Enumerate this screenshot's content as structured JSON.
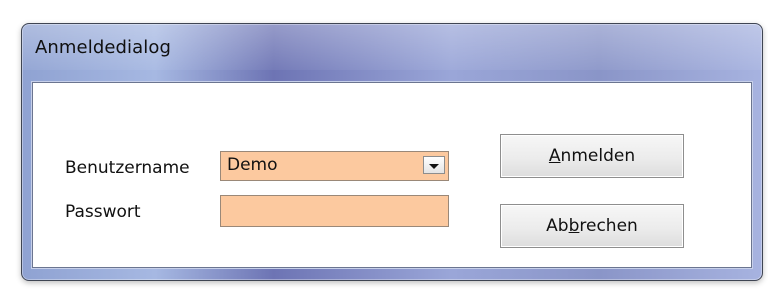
{
  "window": {
    "title": "Anmeldedialog"
  },
  "form": {
    "username_label": "Benutzername",
    "username_value": "Demo",
    "password_label": "Passwort",
    "password_value": ""
  },
  "buttons": {
    "login": {
      "pre": "",
      "mnemonic": "A",
      "post": "nmelden"
    },
    "cancel": {
      "pre": "Ab",
      "mnemonic": "b",
      "post": "rechen"
    }
  },
  "icons": {
    "dropdown": "chevron-down-icon"
  },
  "colors": {
    "field_bg": "#fcc99f"
  }
}
